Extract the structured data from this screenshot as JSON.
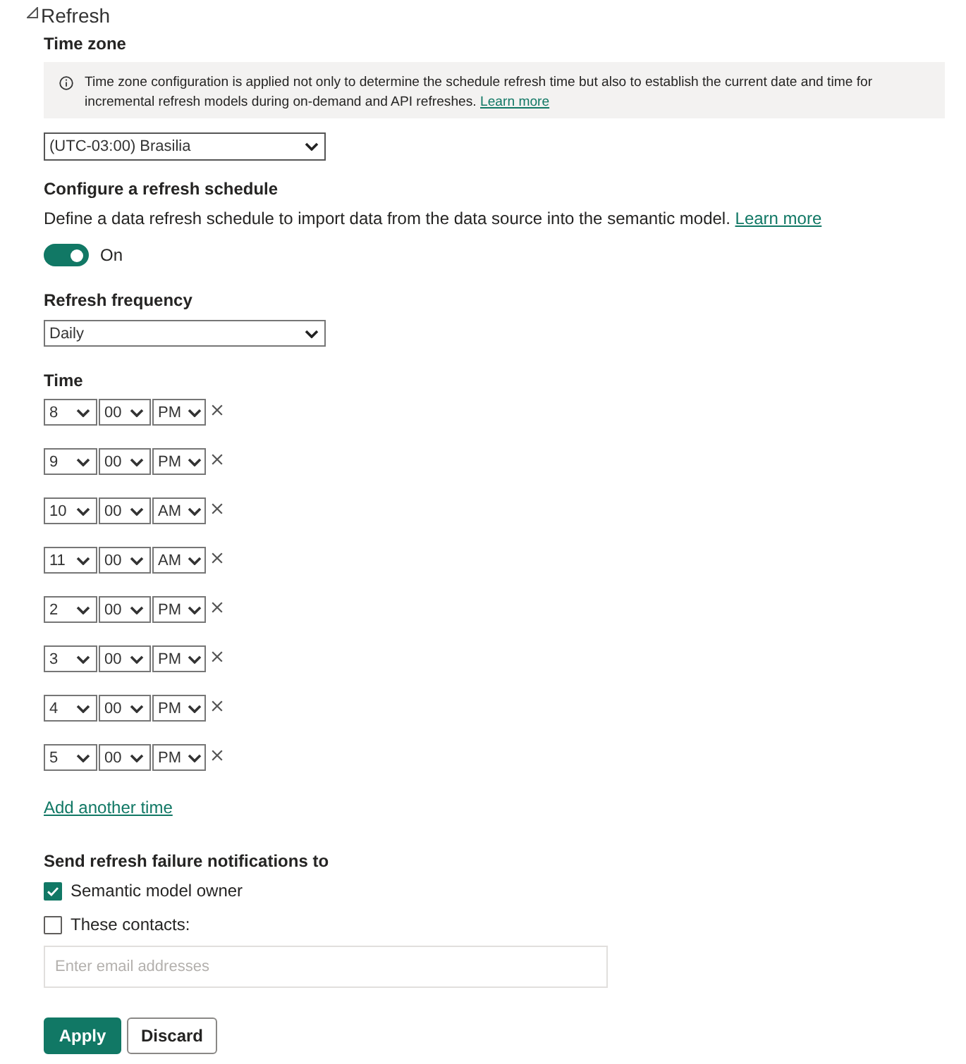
{
  "section": {
    "title": "Refresh",
    "expanded": true
  },
  "time_zone": {
    "label": "Time zone",
    "info": {
      "text": "Time zone configuration is applied not only to determine the schedule refresh time but also to establish the current date and time for incremental refresh models during on-demand and API refreshes.",
      "link": "Learn more"
    },
    "value": "(UTC-03:00) Brasilia"
  },
  "schedule": {
    "title": "Configure a refresh schedule",
    "description": "Define a data refresh schedule to import data from the data source into the semantic model.",
    "link": "Learn more",
    "toggle": {
      "on": true,
      "label": "On"
    }
  },
  "frequency": {
    "label": "Refresh frequency",
    "value": "Daily"
  },
  "times": {
    "label": "Time",
    "rows": [
      {
        "hour": "8",
        "minute": "00",
        "period": "PM"
      },
      {
        "hour": "9",
        "minute": "00",
        "period": "PM"
      },
      {
        "hour": "10",
        "minute": "00",
        "period": "AM"
      },
      {
        "hour": "11",
        "minute": "00",
        "period": "AM"
      },
      {
        "hour": "2",
        "minute": "00",
        "period": "PM"
      },
      {
        "hour": "3",
        "minute": "00",
        "period": "PM"
      },
      {
        "hour": "4",
        "minute": "00",
        "period": "PM"
      },
      {
        "hour": "5",
        "minute": "00",
        "period": "PM"
      }
    ],
    "add_link": "Add another time"
  },
  "notifications": {
    "label": "Send refresh failure notifications to",
    "options": [
      {
        "label": "Semantic model owner",
        "checked": true
      },
      {
        "label": "These contacts:",
        "checked": false
      }
    ],
    "email": {
      "placeholder": "Enter email addresses"
    }
  },
  "buttons": [
    {
      "label": "Apply",
      "kind": "primary"
    },
    {
      "label": "Discard",
      "kind": "secondary"
    }
  ]
}
